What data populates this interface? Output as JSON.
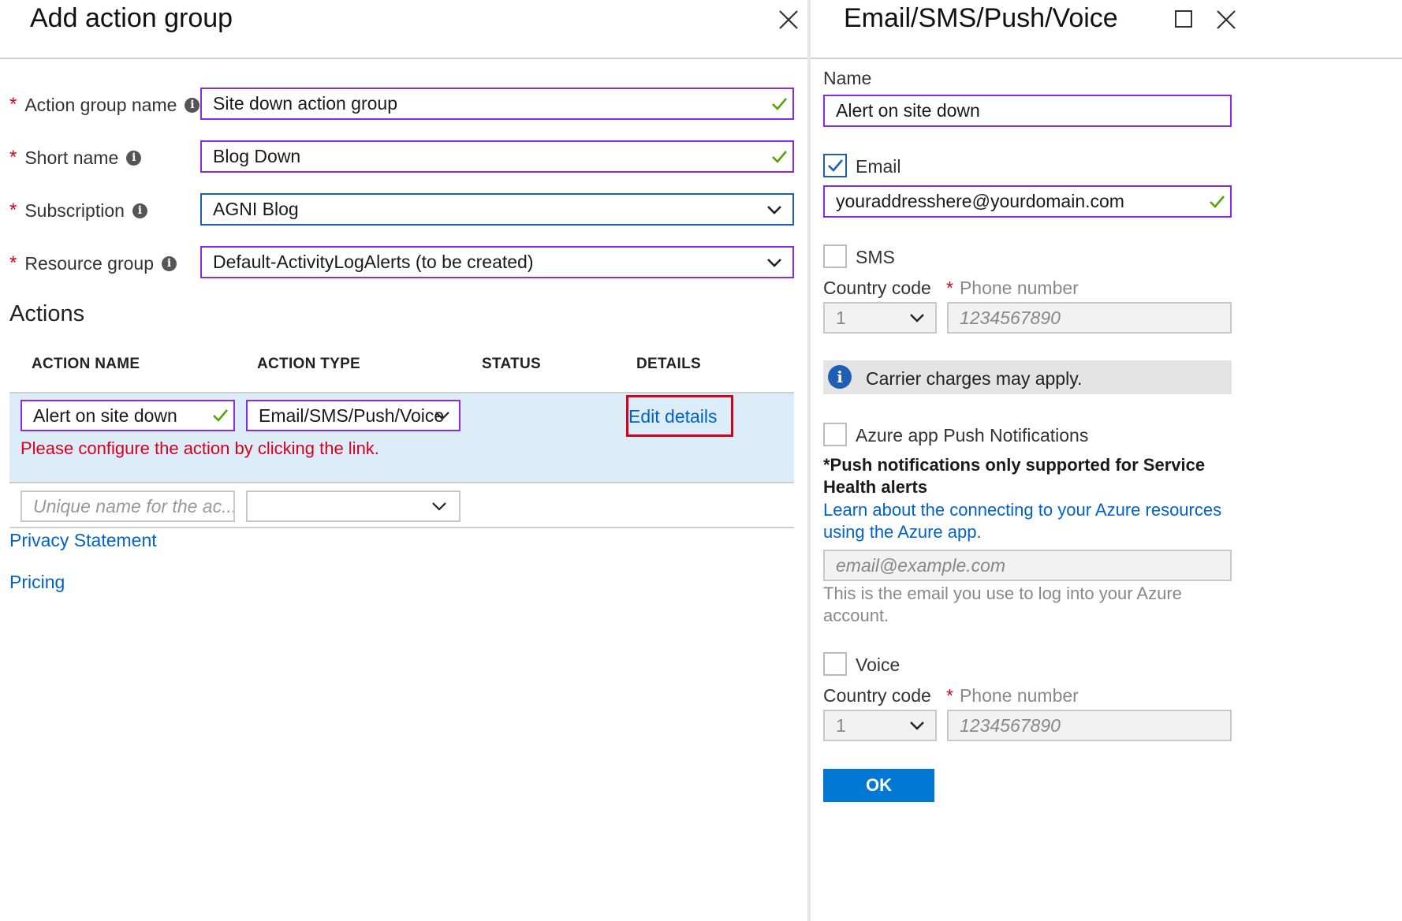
{
  "left": {
    "title": "Add action group",
    "fields": {
      "action_group_name": {
        "label": "Action group name",
        "value": "Site down action group"
      },
      "short_name": {
        "label": "Short name",
        "value": "Blog Down"
      },
      "subscription": {
        "label": "Subscription",
        "value": "AGNI Blog"
      },
      "resource_group": {
        "label": "Resource group",
        "value": "Default-ActivityLogAlerts (to be created)"
      }
    },
    "actions_heading": "Actions",
    "columns": [
      "ACTION NAME",
      "ACTION TYPE",
      "STATUS",
      "DETAILS"
    ],
    "row": {
      "name": "Alert on site down",
      "type": "Email/SMS/Push/Voice",
      "details_link": "Edit details",
      "error": "Please configure the action by clicking the link."
    },
    "new_row": {
      "name_placeholder": "Unique name for the ac..."
    },
    "privacy_link": "Privacy Statement",
    "pricing_link": "Pricing",
    "required_mark": "*",
    "info_mark": "i"
  },
  "right": {
    "title": "Email/SMS/Push/Voice",
    "name_label": "Name",
    "name_value": "Alert on site down",
    "email_label": "Email",
    "email_value": "youraddresshere@yourdomain.com",
    "sms_label": "SMS",
    "country_code_label": "Country code",
    "phone_label": "Phone number",
    "sms_country_code": "1",
    "sms_phone_placeholder": "1234567890",
    "info_banner": "Carrier charges may apply.",
    "push_label": "Azure app Push Notifications",
    "push_note": "*Push notifications only supported for Service Health alerts",
    "push_link": "Learn about the connecting to your Azure resources using the Azure app.",
    "push_email_placeholder": "email@example.com",
    "push_email_hint": "This is the email you use to log into your Azure account.",
    "voice_label": "Voice",
    "voice_country_code": "1",
    "voice_phone_placeholder": "1234567890",
    "ok_label": "OK"
  },
  "colors": {
    "accent": "#0078d4",
    "error": "#d9001b",
    "valid": "#57a300",
    "selected_row": "#ddecf9",
    "link": "#0063c7"
  }
}
